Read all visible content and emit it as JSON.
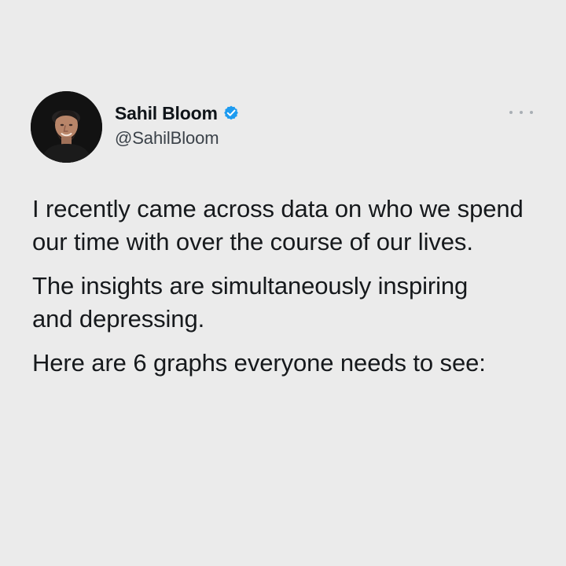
{
  "tweet": {
    "author": {
      "display_name": "Sahil Bloom",
      "handle": "@SahilBloom",
      "verified": true,
      "verified_badge_color": "#1d9bf0"
    },
    "menu_icon": "more-horizontal-icon",
    "paragraphs": [
      "I recently came across data on who we spend our time with over the course of our lives.",
      "The insights are simultaneously inspiring and depressing.",
      "Here are 6 graphs everyone needs to see:"
    ]
  },
  "colors": {
    "background": "#ebebeb",
    "text": "#16191c",
    "secondary_text": "#3b4249",
    "menu_dots": "#a9afb5"
  }
}
